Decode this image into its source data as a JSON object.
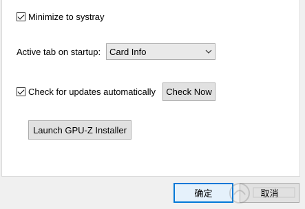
{
  "options": {
    "minimize_to_systray": {
      "label": "Minimize to systray",
      "checked": true
    },
    "active_tab": {
      "label": "Active tab on startup:",
      "value": "Card Info"
    },
    "check_updates": {
      "label": "Check for updates automatically",
      "checked": true
    },
    "check_now_label": "Check Now",
    "launch_installer_label": "Launch GPU-Z Installer"
  },
  "footer": {
    "ok_label": "确定",
    "cancel_label": "取消"
  },
  "colors": {
    "accent": "#0078d7"
  }
}
